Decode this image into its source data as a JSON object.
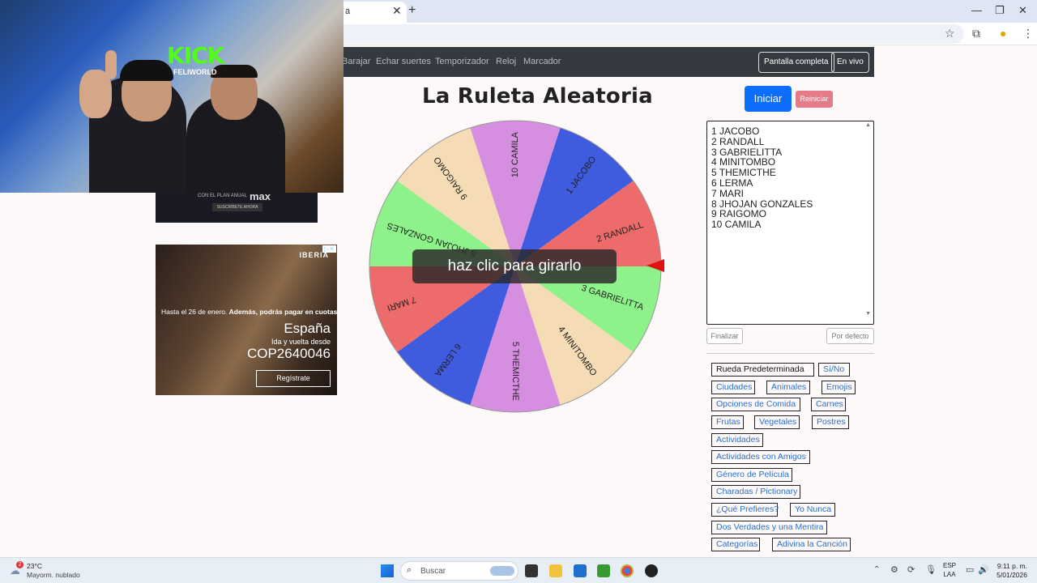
{
  "browser": {
    "tab_title": "a",
    "new_tab": "+",
    "win_min": "—",
    "win_restore": "❐",
    "win_close": "✕"
  },
  "navbar": {
    "links": [
      "Barajar",
      "Echar suertes",
      "Temporizador",
      "Reloj",
      "Marcador"
    ],
    "fullscreen_label": "Pantalla completa",
    "live_label": "En vivo"
  },
  "page": {
    "title": "La Ruleta Aleatoria",
    "start_label": "Iniciar",
    "reset_label": "Reiniciar",
    "spin_hint": "haz clic para girarlo"
  },
  "wheel": {
    "segments": [
      {
        "label": "1 JACOBO",
        "color": "#3f5bde"
      },
      {
        "label": "2 RANDALL",
        "color": "#ee6b6b"
      },
      {
        "label": "3 GABRIELITTA",
        "color": "#8ef28a"
      },
      {
        "label": "4 MINITOMBO",
        "color": "#f5dcb4"
      },
      {
        "label": "5 THEMICTHE",
        "color": "#d68fe0"
      },
      {
        "label": "6 LERMA",
        "color": "#3f5bde"
      },
      {
        "label": "7 MARI",
        "color": "#ee6b6b"
      },
      {
        "label": "8 JHOJAN GONZALES",
        "color": "#8ef28a"
      },
      {
        "label": "9 RAIGOMO",
        "color": "#f5dcb4"
      },
      {
        "label": "10 CAMILA",
        "color": "#d68fe0"
      }
    ]
  },
  "names_list": [
    "1 JACOBO",
    "2 RANDALL",
    "3 GABRIELITTA",
    "4 MINITOMBO",
    "5 THEMICTHE",
    "6 LERMA",
    "7 MARI",
    "8 JHOJAN GONZALES",
    "9 RAIGOMO",
    "10 CAMILA"
  ],
  "list_actions": {
    "finish_label": "Finalizar",
    "default_label": "Por defecto"
  },
  "presets": [
    "Rueda Predeterminada",
    "Sí/No",
    "Ciudades",
    "Animales",
    "Emojis",
    "Opciones de Comida",
    "Carnes",
    "Frutas",
    "Vegetales",
    "Postres",
    "Actividades",
    "Actividades con Amigos",
    "Género de Película",
    "Charadas / Pictionary",
    "¿Qué Prefieres?",
    "Yo Nunca",
    "Dos Verdades y una Mentira",
    "Categorías",
    "Adivina la Canción"
  ],
  "ads": {
    "top_line": "CON EL PLAN ANUAL",
    "top_brand": "max",
    "top_button": "SUSCRÍBETE AHORA",
    "iberia_brand": "IBERIA",
    "iberia_line1_a": "Hasta el 26 de enero. ",
    "iberia_line1_b": "Además, podrás pagar en cuotas.",
    "iberia_destination": "España",
    "iberia_route": "Ida y vuelta desde",
    "iberia_price": "COP2640046",
    "iberia_button": "Regístrate"
  },
  "webcam": {
    "brand": "KICK",
    "channel": "FELIWORLD"
  },
  "taskbar": {
    "weather_temp": "23°C",
    "weather_desc": "Mayorm. nublado",
    "weather_badge": "2",
    "search_placeholder": "Buscar",
    "lang_top": "ESP",
    "lang_bottom": "LAA",
    "time": "9:11 p. m.",
    "date": "5/01/2026"
  }
}
